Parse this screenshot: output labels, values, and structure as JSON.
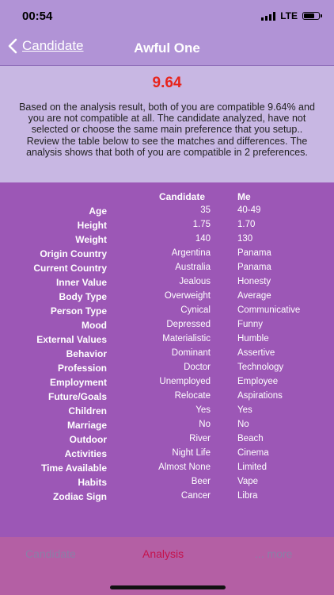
{
  "status": {
    "time": "00:54",
    "network": "LTE"
  },
  "nav": {
    "back_label": "Candidate",
    "title": "Awful One"
  },
  "summary": {
    "score": "9.64",
    "text": "Based on the analysis result, both of you are compatible 9.64% and you are not compatible at all. The candidate analyzed,  have not selected or choose the same main preference that you setup.. Review the table below to see the matches and differences. The analysis shows that both of you are compatible in    2 preferences."
  },
  "table": {
    "headers": {
      "candidate": "Candidate",
      "me": "Me"
    },
    "rows": [
      {
        "label": "Age",
        "candidate": "35",
        "me": "40-49"
      },
      {
        "label": "Height",
        "candidate": "1.75",
        "me": "1.70"
      },
      {
        "label": "Weight",
        "candidate": "140",
        "me": "130"
      },
      {
        "label": "Origin Country",
        "candidate": "Argentina",
        "me": "Panama"
      },
      {
        "label": "Current Country",
        "candidate": "Australia",
        "me": "Panama"
      },
      {
        "label": "Inner Value",
        "candidate": "Jealous",
        "me": "Honesty"
      },
      {
        "label": "Body Type",
        "candidate": "Overweight",
        "me": "Average"
      },
      {
        "label": "Person Type",
        "candidate": "Cynical",
        "me": "Communicative"
      },
      {
        "label": "Mood",
        "candidate": "Depressed",
        "me": "Funny"
      },
      {
        "label": "External Values",
        "candidate": "Materialistic",
        "me": "Humble"
      },
      {
        "label": "Behavior",
        "candidate": "Dominant",
        "me": "Assertive"
      },
      {
        "label": "Profession",
        "candidate": "Doctor",
        "me": "Technology"
      },
      {
        "label": "Employment",
        "candidate": "Unemployed",
        "me": "Employee"
      },
      {
        "label": "Future/Goals",
        "candidate": "Relocate",
        "me": "Aspirations"
      },
      {
        "label": "Children",
        "candidate": "Yes",
        "me": "Yes"
      },
      {
        "label": "Marriage",
        "candidate": "No",
        "me": "No"
      },
      {
        "label": "Outdoor",
        "candidate": "River",
        "me": "Beach"
      },
      {
        "label": "Activities",
        "candidate": "Night Life",
        "me": "Cinema"
      },
      {
        "label": "Time Available",
        "candidate": "Almost None",
        "me": "Limited"
      },
      {
        "label": "Habits",
        "candidate": "Beer",
        "me": "Vape"
      },
      {
        "label": "Zodiac Sign",
        "candidate": "Cancer",
        "me": "Libra"
      }
    ]
  },
  "tabs": [
    {
      "label": "Candidate"
    },
    {
      "label": "Analysis"
    },
    {
      "label": "... more"
    }
  ],
  "colors": {
    "score": "#e8231b",
    "active_tab": "#c4124c",
    "inactive_tab": "#8a7fa7",
    "table_bg": "#9c57b6",
    "summary_bg": "#c8b7e3"
  }
}
